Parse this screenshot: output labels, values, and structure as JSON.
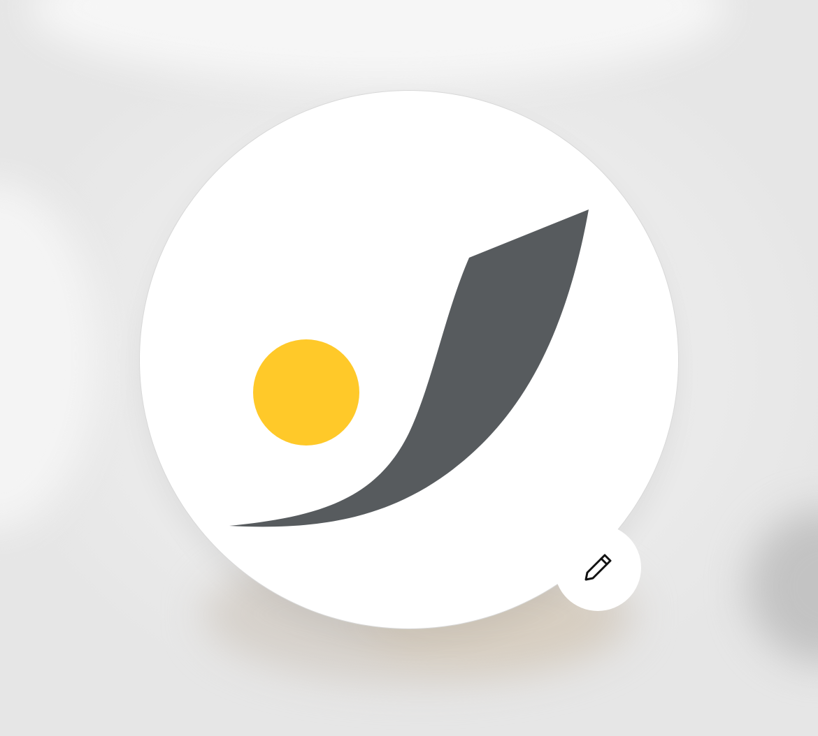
{
  "profile": {
    "avatar": {
      "kind": "organization-logo",
      "logo_colors": {
        "sun": "#ffc929",
        "swoosh": "#575b5e",
        "background": "#ffffff"
      }
    },
    "edit_action": {
      "icon": "pencil-icon",
      "icon_color": "#111111"
    }
  }
}
